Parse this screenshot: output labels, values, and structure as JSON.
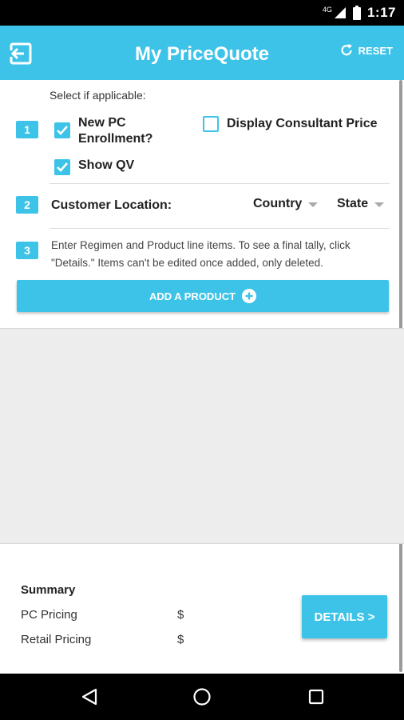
{
  "status": {
    "signal_label": "4G",
    "time": "1:17"
  },
  "appbar": {
    "title": "My PriceQuote",
    "reset_label": "RESET"
  },
  "step1": {
    "badge": "1",
    "hint": "Select if applicable:",
    "options": [
      {
        "label_line1": "New PC",
        "label_line2": "Enrollment?",
        "checked": true
      },
      {
        "label": "Display Consultant Price",
        "checked": false
      },
      {
        "label": "Show QV",
        "checked": true
      }
    ]
  },
  "step2": {
    "badge": "2",
    "label": "Customer Location:",
    "country": "Country",
    "state": "State"
  },
  "step3": {
    "badge": "3",
    "instructions": "Enter Regimen and Product line items. To see a final tally, click \"Details.\" Items can't be edited once added, only deleted.",
    "add_label": "ADD A PRODUCT"
  },
  "summary": {
    "title": "Summary",
    "rows": [
      {
        "label": "PC Pricing",
        "value": "$"
      },
      {
        "label": "Retail Pricing",
        "value": "$"
      }
    ],
    "details_label": "DETAILS >"
  },
  "colors": {
    "accent": "#3ec3e8",
    "gray_area": "#ededed"
  },
  "icons": {
    "back": "exit-to-app-icon",
    "reset": "refresh-icon",
    "add": "plus-circle-icon"
  }
}
